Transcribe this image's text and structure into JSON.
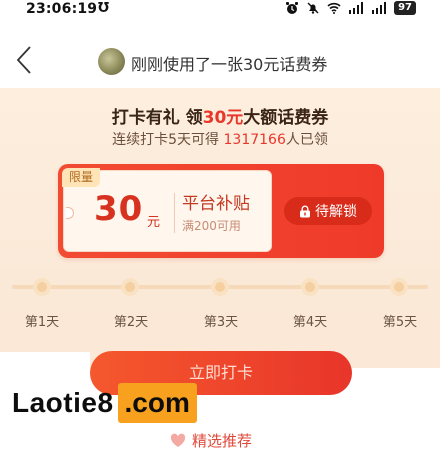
{
  "status_bar": {
    "time": "23:06:19",
    "app_glyph": "Ʊ",
    "battery": "97",
    "icons": [
      "alarm-icon",
      "mute-icon",
      "wifi-icon",
      "signal-5g-icon",
      "signal-4g-icon",
      "battery-icon"
    ]
  },
  "header": {
    "title": "刚刚使用了一张30元话费券"
  },
  "promo": {
    "title_prefix": "打卡有礼 领",
    "title_highlight": "30元",
    "title_suffix": "大额话费券",
    "subtitle_prefix": "连续打卡5天可得 ",
    "subtitle_count": "1317166",
    "subtitle_suffix": "人已领"
  },
  "coupon": {
    "tag": "限量",
    "amount": "30",
    "unit": "元",
    "name": "平台补贴",
    "condition": "满200可用",
    "button": "待解锁"
  },
  "timeline": {
    "days": [
      "第1天",
      "第2天",
      "第3天",
      "第4天",
      "第5天"
    ]
  },
  "cta": {
    "label": "立即打卡"
  },
  "watermark": {
    "main": "Laotie8",
    "box": ".com"
  },
  "recommend": {
    "label": "精选推荐"
  }
}
